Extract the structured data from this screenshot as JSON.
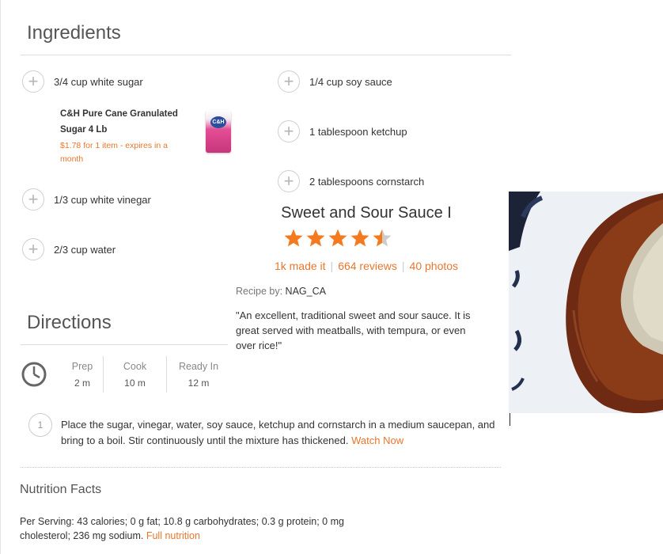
{
  "ingredients": {
    "title": "Ingredients",
    "left": [
      {
        "text": "3/4 cup white sugar"
      },
      {
        "text": "1/3 cup white vinegar"
      },
      {
        "text": "2/3 cup water"
      }
    ],
    "right": [
      {
        "text": "1/4 cup soy sauce"
      },
      {
        "text": "1 tablespoon ketchup"
      },
      {
        "text": "2 tablespoons cornstarch"
      }
    ],
    "product": {
      "name": "C&H Pure Cane Granulated Sugar 4 Lb",
      "price": "$1.78 for 1 item - expires in a month",
      "logo": "C&H",
      "image_icon": "sugar-bag-icon"
    },
    "plus_icon": "+"
  },
  "recipe": {
    "title": "Sweet and Sour Sauce I",
    "rating": 4.5,
    "made_it": "1k made it",
    "reviews": "664 reviews",
    "photos": "40 photos",
    "by_label": "Recipe by:",
    "author": "NAG_CA",
    "description": "\"An excellent, traditional sweet and sour sauce. It is great served with meatballs, with tempura, or even over rice!\""
  },
  "directions": {
    "title": "Directions",
    "times": [
      {
        "label": "Prep",
        "value": "2 m"
      },
      {
        "label": "Cook",
        "value": "10 m"
      },
      {
        "label": "Ready In",
        "value": "12 m"
      }
    ],
    "steps": [
      {
        "number": "1",
        "text": "Place the sugar, vinegar, water, soy sauce, ketchup and cornstarch in a medium saucepan, and bring to a boil. Stir continuously until the mixture has thickened.",
        "link": "Watch Now"
      }
    ]
  },
  "nutrition": {
    "title": "Nutrition Facts",
    "text": "Per Serving: 43 calories; 0 g fat; 10.8 g carbohydrates; 0.3 g protein; 0 mg cholesterol; 236 mg sodium.",
    "link": "Full nutrition"
  },
  "colors": {
    "accent": "#e8772e",
    "star": "#f47a20",
    "star_empty": "#cccccc"
  }
}
